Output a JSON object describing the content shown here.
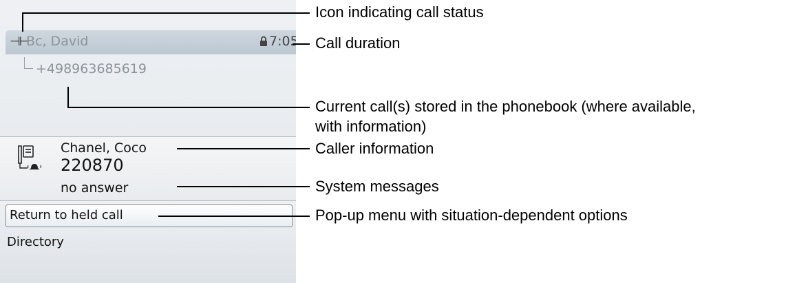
{
  "call": {
    "status_icon": "⊣⊢",
    "caller_name": "Bc, David",
    "duration": "7:05",
    "number": "+498963685619"
  },
  "incoming": {
    "name": "Chanel, Coco",
    "number": "220870",
    "system_message": "no answer"
  },
  "menu": {
    "items": [
      "Return to held call",
      "Directory"
    ]
  },
  "annotations": {
    "status_icon": "Icon indicating call status",
    "call_duration": "Call duration",
    "phonebook_line1": "Current call(s) stored in the phonebook (where available,",
    "phonebook_line2": "with information)",
    "caller_info": "Caller information",
    "system_messages": "System messages",
    "popup_menu": "Pop-up menu with situation-dependent options"
  },
  "icons": {
    "lock": "lock-icon",
    "phone": "ringing-phone-icon",
    "call_status": "call-status-icon"
  },
  "colors": {
    "header": "#c6cfd7",
    "screen": "#eef0f3",
    "selected_border": "#7e8790"
  }
}
